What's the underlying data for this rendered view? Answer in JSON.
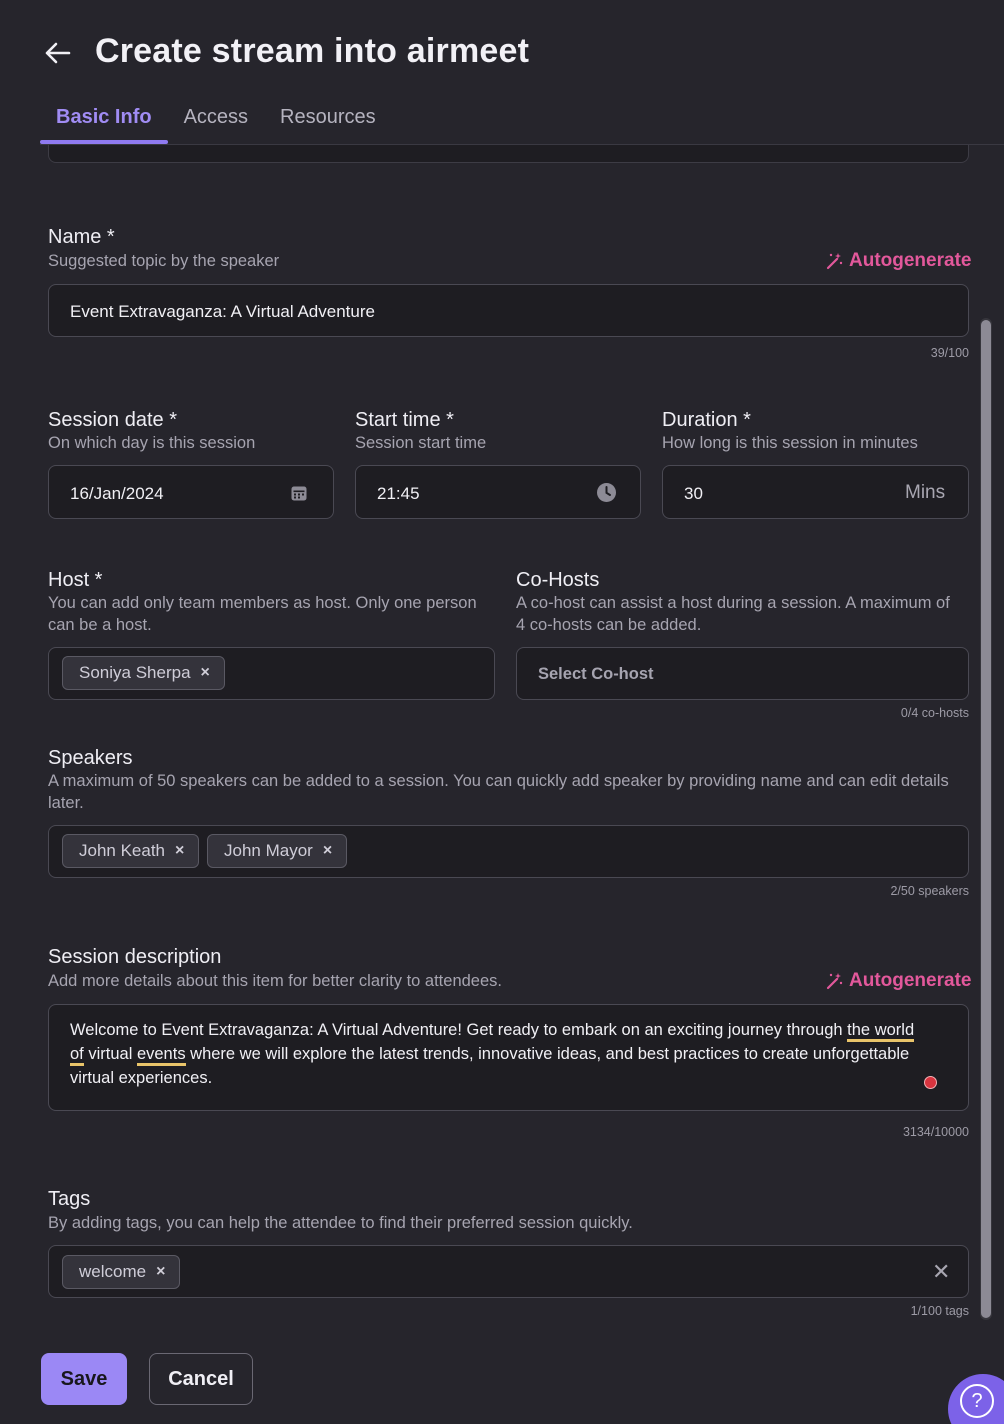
{
  "header": {
    "title": "Create stream into airmeet",
    "tabs": [
      {
        "label": "Basic Info",
        "active": true
      },
      {
        "label": "Access",
        "active": false
      },
      {
        "label": "Resources",
        "active": false
      }
    ]
  },
  "name": {
    "label": "Name *",
    "hint": "Suggested topic by the speaker",
    "autogenerate": "Autogenerate",
    "value": "Event Extravaganza: A Virtual Adventure",
    "counter": "39/100"
  },
  "session_date": {
    "label": "Session date *",
    "hint": "On which day is this session",
    "value": "16/Jan/2024"
  },
  "start_time": {
    "label": "Start time *",
    "hint": "Session start time",
    "value": "21:45"
  },
  "duration": {
    "label": "Duration *",
    "hint": "How long is this session in minutes",
    "value": "30",
    "unit": "Mins"
  },
  "host": {
    "label": "Host *",
    "hint_line1": "You can add only team members as host. Only one person",
    "hint_line2": "can be a host.",
    "chips": [
      "Soniya Sherpa"
    ]
  },
  "cohosts": {
    "label": "Co-Hosts",
    "hint_line1": "A co-host can assist a host during a session. A maximum of",
    "hint_line2": "4 co-hosts can be added.",
    "placeholder": "Select Co-host",
    "counter": "0/4 co-hosts"
  },
  "speakers": {
    "label": "Speakers",
    "hint_line1": "A maximum of 50 speakers can be added to a session. You can quickly add speaker by providing name and can edit details",
    "hint_line2": "later.",
    "chips": [
      "John Keath",
      "John Mayor"
    ],
    "counter": "2/50 speakers"
  },
  "description": {
    "label": "Session description",
    "hint": "Add more details about this item for better clarity to attendees.",
    "autogenerate": "Autogenerate",
    "line1_a": "Welcome to Event Extravaganza: A Virtual Adventure! Get ready to embark on an exciting journey through ",
    "line1_b": "the world",
    "line2_a": "of",
    "line2_b": " virtual ",
    "line2_c": "events",
    "line2_d": " where we will explore the latest trends, innovative ideas, and best practices to create unforgettable",
    "line3": "virtual experiences.",
    "counter": "3134/10000"
  },
  "tags": {
    "label": "Tags",
    "hint": "By adding tags, you can help the attendee to find their preferred session quickly.",
    "chips": [
      "welcome"
    ],
    "counter": "1/100 tags"
  },
  "footer": {
    "save": "Save",
    "cancel": "Cancel"
  },
  "icons": {
    "remove": "×",
    "clear": "✕",
    "help": "?"
  },
  "colors": {
    "accent": "#9b88f5",
    "autogenerate": "#e2589b",
    "background": "#26252c",
    "field": "#1e1d22"
  }
}
